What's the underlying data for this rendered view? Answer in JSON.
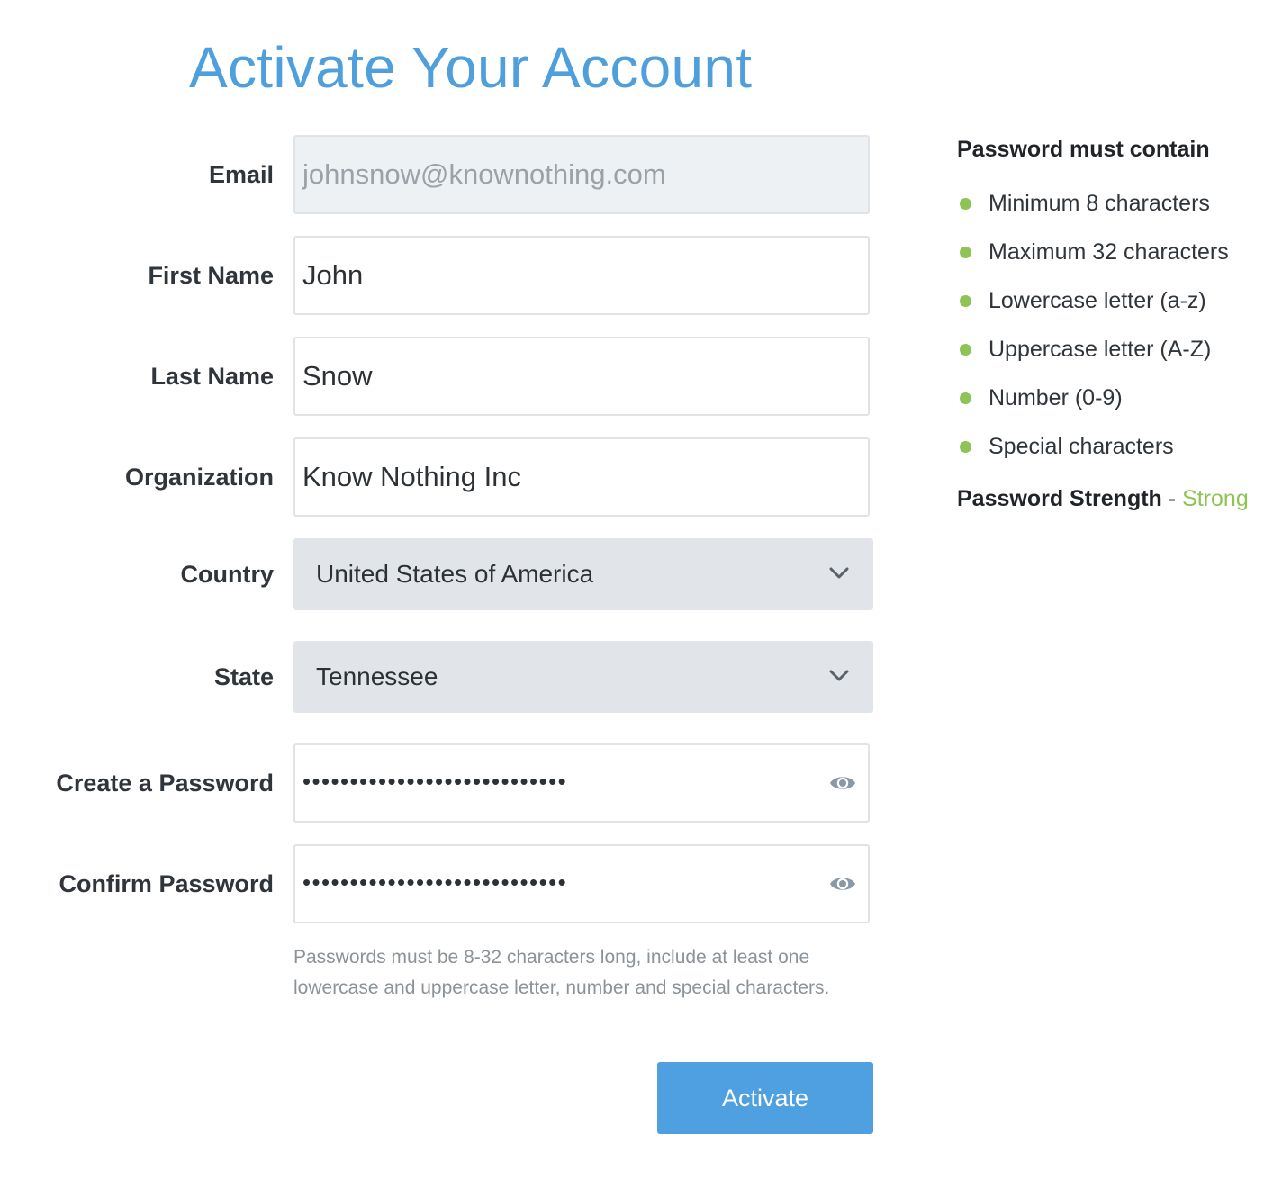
{
  "page": {
    "title": "Activate Your Account"
  },
  "form": {
    "email": {
      "label": "Email",
      "value": "johnsnow@knownothing.com"
    },
    "first_name": {
      "label": "First Name",
      "value": "John"
    },
    "last_name": {
      "label": "Last Name",
      "value": "Snow"
    },
    "organization": {
      "label": "Organization",
      "value": "Know Nothing Inc"
    },
    "country": {
      "label": "Country",
      "value": "United States of America"
    },
    "state": {
      "label": "State",
      "value": "Tennessee"
    },
    "password": {
      "label": "Create a Password",
      "masked": "••••••••••••••••••••••••••••"
    },
    "confirm_password": {
      "label": "Confirm Password",
      "masked": "••••••••••••••••••••••••••••"
    },
    "hint": "Passwords must be 8-32 characters long, include at least one lowercase and uppercase letter, number and special characters.",
    "submit_label": "Activate"
  },
  "requirements": {
    "title": "Password must contain",
    "items": [
      {
        "label": "Minimum 8 characters",
        "met": true
      },
      {
        "label": "Maximum 32 characters",
        "met": true
      },
      {
        "label": "Lowercase letter (a-z)",
        "met": true
      },
      {
        "label": "Uppercase letter (A-Z)",
        "met": true
      },
      {
        "label": "Number (0-9)",
        "met": true
      },
      {
        "label": "Special characters",
        "met": true
      }
    ],
    "strength_label": "Password Strength",
    "strength_separator": "-",
    "strength_value": "Strong"
  },
  "colors": {
    "title": "#4f9fdd",
    "button": "#4fa0e0",
    "success": "#8ec456",
    "readonly_bg": "#eef1f4",
    "select_bg": "#e1e5e9"
  },
  "icons": {
    "select": "chevron-down-icon",
    "reveal": "eye-icon",
    "bullet": "check-bullet-icon"
  }
}
